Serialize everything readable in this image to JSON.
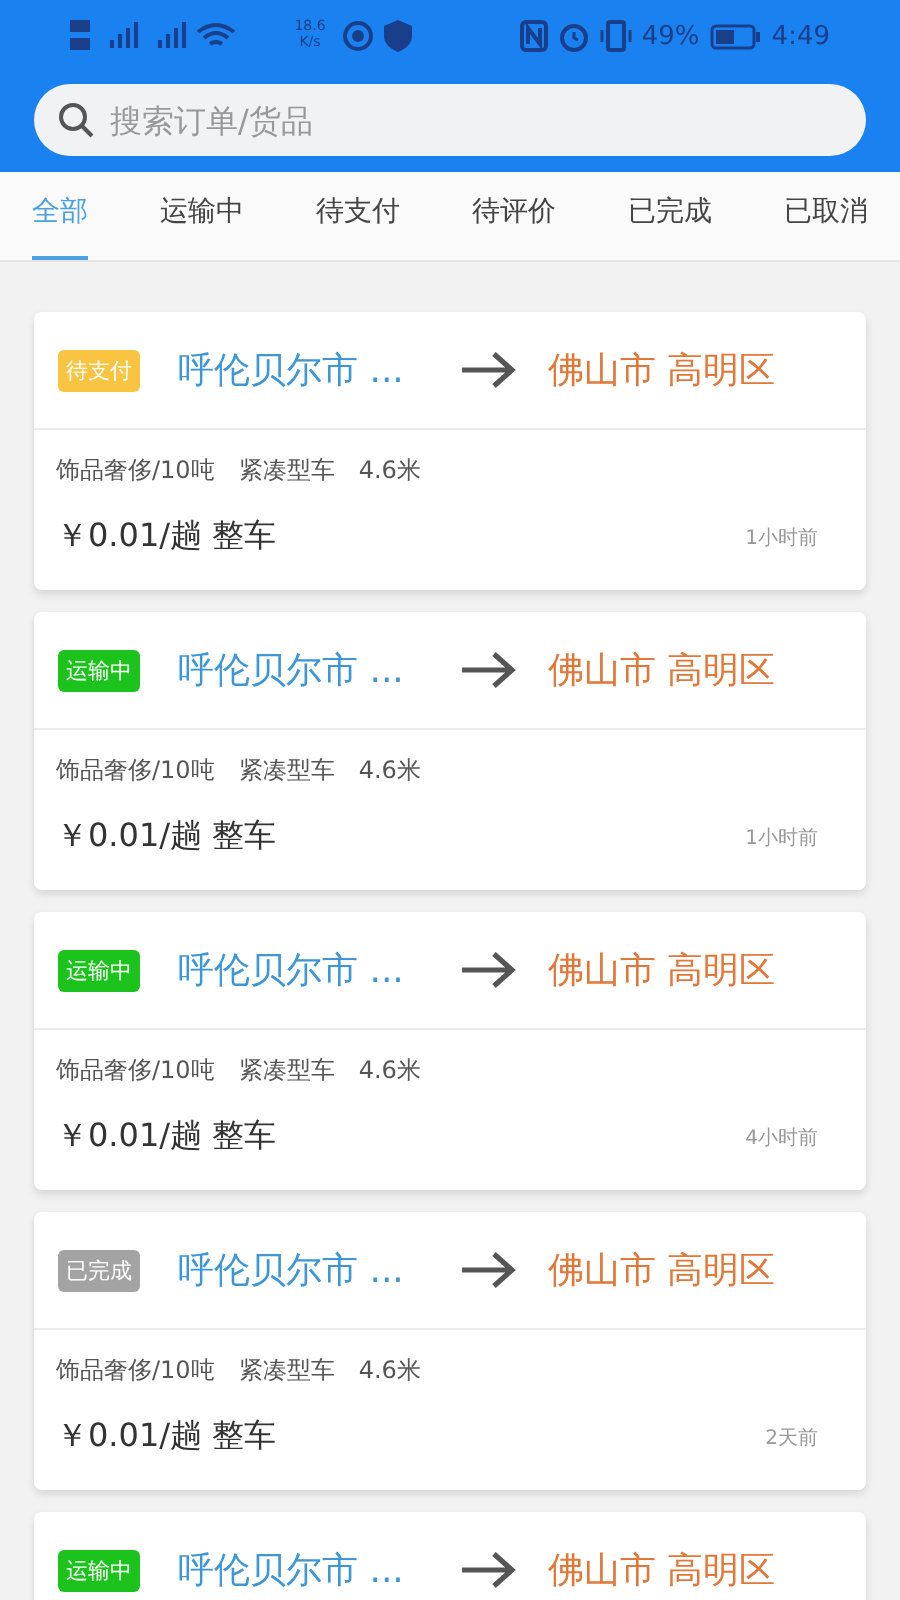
{
  "status_bar": {
    "net_speed": "18.6 K/s",
    "battery": "49%",
    "time": "4:49"
  },
  "search": {
    "placeholder": "搜索订单/货品"
  },
  "tabs": [
    {
      "label": "全部",
      "selected": true
    },
    {
      "label": "运输中",
      "selected": false
    },
    {
      "label": "待支付",
      "selected": false
    },
    {
      "label": "待评价",
      "selected": false
    },
    {
      "label": "已完成",
      "selected": false
    },
    {
      "label": "已取消",
      "selected": false
    }
  ],
  "orders": [
    {
      "status": "待支付",
      "color": "#f8c441",
      "origin": "呼伦贝尔市 ...",
      "destination": "佛山市 高明区",
      "cargo": "饰品奢侈/10吨",
      "vehicle": "紧凑型车",
      "length": "4.6米",
      "price": "￥0.01/趟 整车",
      "time": "1小时前"
    },
    {
      "status": "运输中",
      "color": "#1cc31c",
      "origin": "呼伦贝尔市 ...",
      "destination": "佛山市 高明区",
      "cargo": "饰品奢侈/10吨",
      "vehicle": "紧凑型车",
      "length": "4.6米",
      "price": "￥0.01/趟 整车",
      "time": "1小时前"
    },
    {
      "status": "运输中",
      "color": "#1cc31c",
      "origin": "呼伦贝尔市 ...",
      "destination": "佛山市 高明区",
      "cargo": "饰品奢侈/10吨",
      "vehicle": "紧凑型车",
      "length": "4.6米",
      "price": "￥0.01/趟 整车",
      "time": "4小时前"
    },
    {
      "status": "已完成",
      "color": "#a3a3a3",
      "origin": "呼伦贝尔市 ...",
      "destination": "佛山市 高明区",
      "cargo": "饰品奢侈/10吨",
      "vehicle": "紧凑型车",
      "length": "4.6米",
      "price": "￥0.01/趟 整车",
      "time": "2天前"
    },
    {
      "status": "运输中",
      "color": "#1cc31c",
      "origin": "呼伦贝尔市 ...",
      "destination": "佛山市 高明区"
    }
  ]
}
